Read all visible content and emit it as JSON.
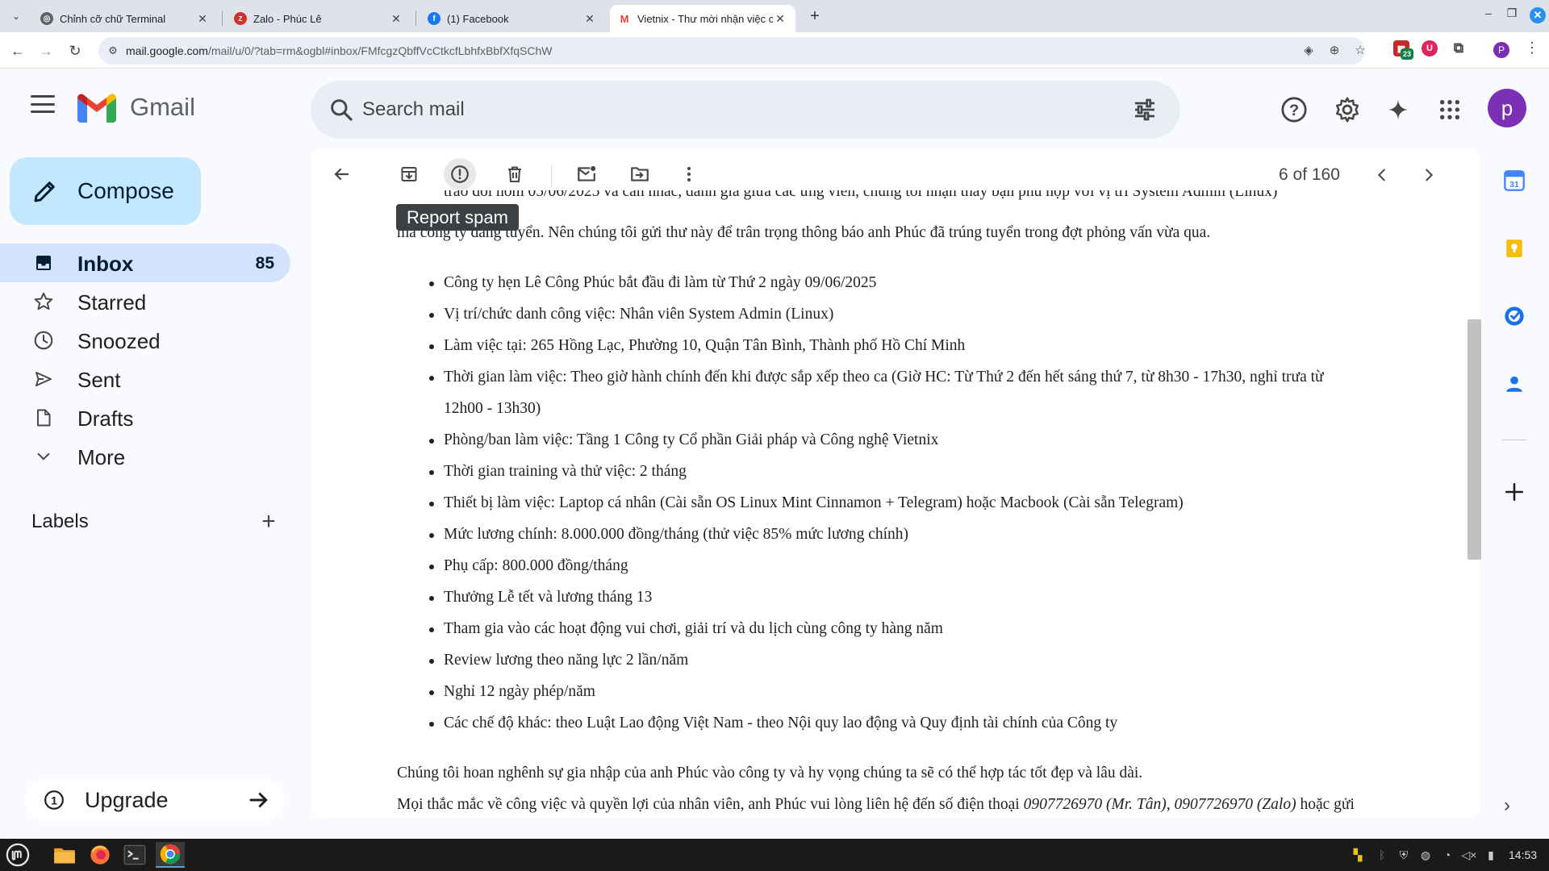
{
  "browser": {
    "tabs": [
      {
        "title": "Chỉnh cỡ chữ Terminal",
        "active": false
      },
      {
        "title": "Zalo - Phúc Lê",
        "active": false
      },
      {
        "title": "(1) Facebook",
        "active": false
      },
      {
        "title": "Vietnix - Thư mời nhận việc c",
        "active": true
      }
    ],
    "url_host": "mail.google.com",
    "url_path": "/mail/u/0/?tab=rm&ogbl#inbox/FMfcgzQbffVcCtkcfLbhfxBbfXfqSChW",
    "extension_badge": "23",
    "profile_initial": "P"
  },
  "gmail": {
    "brand": "Gmail",
    "search_placeholder": "Search mail",
    "avatar_initial": "p",
    "compose_label": "Compose",
    "nav": [
      {
        "label": "Inbox",
        "count": "85",
        "icon": "inbox-icon",
        "active": true
      },
      {
        "label": "Starred",
        "count": "",
        "icon": "star-icon",
        "active": false
      },
      {
        "label": "Snoozed",
        "count": "",
        "icon": "clock-icon",
        "active": false
      },
      {
        "label": "Sent",
        "count": "",
        "icon": "send-icon",
        "active": false
      },
      {
        "label": "Drafts",
        "count": "",
        "icon": "draft-icon",
        "active": false
      },
      {
        "label": "More",
        "count": "",
        "icon": "chevron-down-icon",
        "active": false
      }
    ],
    "labels_title": "Labels",
    "upgrade_label": "Upgrade"
  },
  "message": {
    "pager": "6 of 160",
    "tooltip": "Report spam",
    "partial_line": "trao đổi hôm 05/06/2025 và cân nhắc, đánh giá giữa các ứng viên, chúng tôi nhận thấy bạn phù hợp với vị trí System Admin (Linux)",
    "intro_line": "mà công ty đang tuyển. Nên chúng tôi gửi thư này để trân trọng thông báo anh Phúc đã trúng tuyển trong đợt phỏng vấn vừa qua.",
    "bullets": [
      "Công ty hẹn Lê Công Phúc bắt đầu đi làm từ Thứ 2 ngày 09/06/2025",
      "Vị trí/chức danh công việc: Nhân viên System Admin (Linux)",
      "Làm việc tại: 265 Hồng Lạc, Phường 10, Quận Tân Bình, Thành phố Hồ Chí Minh",
      "Thời gian làm việc: Theo giờ hành chính đến khi được sắp xếp theo ca (Giờ HC: Từ Thứ 2 đến hết sáng thứ 7, từ 8h30 - 17h30, nghỉ trưa từ",
      "12h00 - 13h30)",
      "Phòng/ban làm việc: Tầng 1 Công ty Cổ phần Giải pháp và Công nghệ Vietnix",
      "Thời gian training và thử việc: 2 tháng",
      "Thiết bị làm việc: Laptop cá nhân (Cài sẵn OS Linux Mint Cinnamon + Telegram) hoặc Macbook (Cài sẵn Telegram)",
      "Mức lương chính: 8.000.000 đồng/tháng (thử việc 85% mức lương chính)",
      "Phụ cấp: 800.000 đồng/tháng",
      "Thưởng Lễ tết và lương tháng 13",
      "Tham gia vào các hoạt động vui chơi, giải trí và du lịch cùng công ty hàng năm",
      "Review lương theo năng lực 2 lần/năm",
      "Nghỉ 12 ngày phép/năm",
      "Các chế độ khác: theo Luật Lao động Việt Nam - theo Nội quy lao động và Quy định tài chính của Công ty"
    ],
    "closing_line": "Chúng tôi hoan nghênh sự gia nhập của anh Phúc vào công ty và hy vọng chúng ta sẽ có thể hợp tác tốt đẹp và lâu dài.",
    "contact_prefix": "Mọi thắc mắc về công việc và quyền lợi của nhân viên, anh Phúc vui lòng liên hệ đến số điện thoại ",
    "contact_phone1": "0907726970 (Mr. Tân)",
    "contact_sep": ", ",
    "contact_phone2": "0907726970 (Zalo)",
    "contact_suffix": " hoặc gửi"
  },
  "taskbar": {
    "clock": "14:53"
  },
  "colors": {
    "accent": "#0b57d0",
    "compose_bg": "#c2e7ff",
    "nav_active": "#d3e3fd",
    "avatar": "#7b2fb5"
  }
}
